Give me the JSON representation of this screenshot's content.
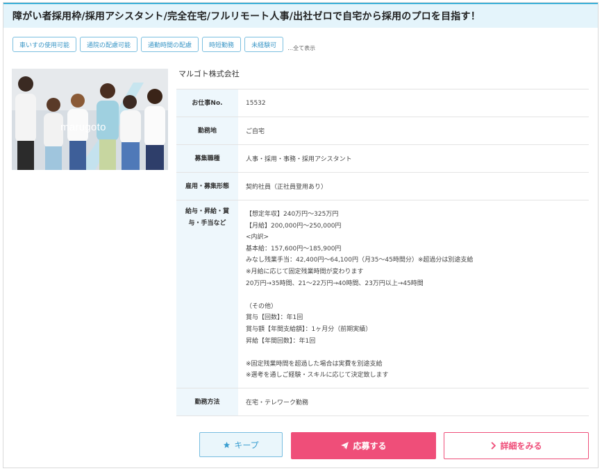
{
  "job": {
    "title": "障がい者採用枠/採用アシスタント/完全在宅/フルリモート人事/出社ゼロで自宅から採用のプロを目指す！",
    "tags": [
      "車いすの使用可能",
      "通院の配慮可能",
      "通勤時間の配慮",
      "時短勤務",
      "未経験可"
    ],
    "show_all": "…全て表示",
    "photo_logo": "marugoto",
    "company": "マルゴト株式会社",
    "fields": {
      "job_no": {
        "label": "お仕事No.",
        "value": "15532"
      },
      "location": {
        "label": "勤務地",
        "value": "ご自宅"
      },
      "category": {
        "label": "募集職種",
        "value": "人事・採用・事務・採用アシスタント"
      },
      "employment": {
        "label": "雇用・募集形態",
        "value": "契約社員（正社員登用あり）"
      },
      "salary": {
        "label_line1": "給与・昇給・賞",
        "label_line2": "与・手当など",
        "lines": [
          "【想定年収】240万円～325万円",
          "【月給】200,000円～250,000円",
          "<内訳>",
          "基本給：157,600円～185,900円",
          "みなし残業手当：42,400円～64,100円（月35～45時間分）※超過分は別途支給",
          "※月給に応じて固定残業時間が変わります",
          "20万円→35時間、21～22万円→40時間、23万円以上→45時間",
          "",
          "（その他）",
          "賞与【回数】：年1回",
          "賞与額【年間支給額】：1ヶ月分（前期実績）",
          "昇給【年間回数】：年1回",
          "",
          "※固定残業時間を超過した場合は実費を別途支給",
          "※選考を通しご経験・スキルに応じて決定致します"
        ]
      },
      "work_style": {
        "label": "勤務方法",
        "value": "在宅・テレワーク勤務"
      }
    }
  },
  "actions": {
    "keep_label": "キープ",
    "apply_label": "応募する",
    "detail_label": "詳細をみる"
  },
  "icons": {
    "keep": "star-icon",
    "apply": "paper-plane-icon",
    "detail": "chevron-right-icon"
  },
  "colors": {
    "accent_blue": "#3fb1d8",
    "apply_pink": "#ef4e79",
    "label_bg": "#eef7fc"
  }
}
